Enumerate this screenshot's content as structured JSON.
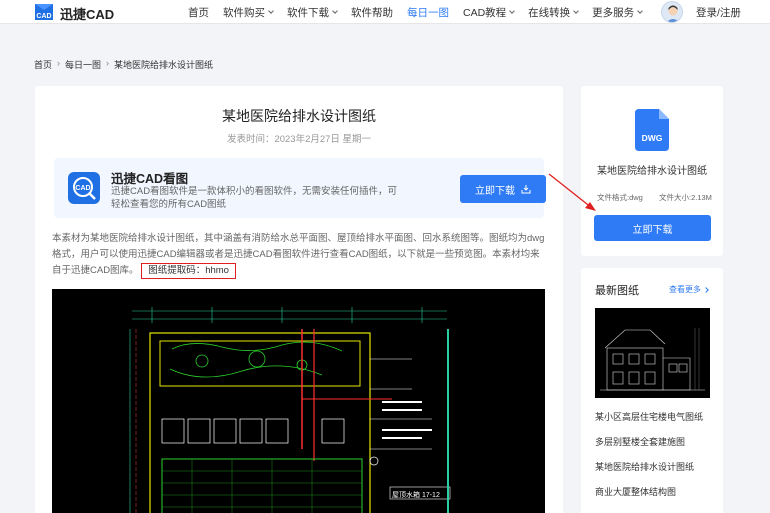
{
  "brand": {
    "name": "迅捷CAD",
    "logo_text": "CAD"
  },
  "nav": {
    "items": [
      {
        "label": "首页",
        "dropdown": false,
        "active": false
      },
      {
        "label": "软件购买",
        "dropdown": true,
        "active": false
      },
      {
        "label": "软件下载",
        "dropdown": true,
        "active": false
      },
      {
        "label": "软件帮助",
        "dropdown": false,
        "active": false
      },
      {
        "label": "每日一图",
        "dropdown": false,
        "active": true
      },
      {
        "label": "CAD教程",
        "dropdown": true,
        "active": false
      },
      {
        "label": "在线转换",
        "dropdown": true,
        "active": false
      },
      {
        "label": "更多服务",
        "dropdown": true,
        "active": false
      }
    ],
    "login_label": "登录/注册"
  },
  "breadcrumb": {
    "home": "首页",
    "section": "每日一图",
    "current": "某地医院给排水设计图纸"
  },
  "article": {
    "title": "某地医院给排水设计图纸",
    "date": "发表时间：2023年2月27日 星期一",
    "body": "本素材为某地医院给排水设计图纸，其中涵盖有消防给水总平面图、屋顶给排水平面图、回水系统图等。图纸均为dwg格式，用户可以使用迅捷CAD编辑器或者是迅捷CAD看图软件进行查看CAD图纸，以下就是一些预览图。本素材均来自于迅捷CAD图库。",
    "code_label": "图纸提取码：hhmo"
  },
  "promo": {
    "name": "迅捷CAD看图",
    "desc": "迅捷CAD看图软件是一款体积小的看图软件，无需安装任何插件，可轻松查看您的所有CAD图纸",
    "button": "立即下载",
    "icon_text": "CAD"
  },
  "download_card": {
    "icon_text": "DWG",
    "title": "某地医院给排水设计图纸",
    "format": "文件格式:dwg",
    "size": "文件大小:2.13M",
    "button": "立即下载"
  },
  "latest": {
    "heading": "最新图纸",
    "more": "查看更多",
    "items": [
      "某小区高层住宅楼电气图纸",
      "多层别墅楼全套建施图",
      "某地医院给排水设计图纸",
      "商业大厦整体结构图"
    ]
  },
  "drawing": {
    "label": "屋顶水箱 17-12"
  },
  "colors": {
    "accent": "#2f7bf5",
    "annotation": "#e02020"
  }
}
